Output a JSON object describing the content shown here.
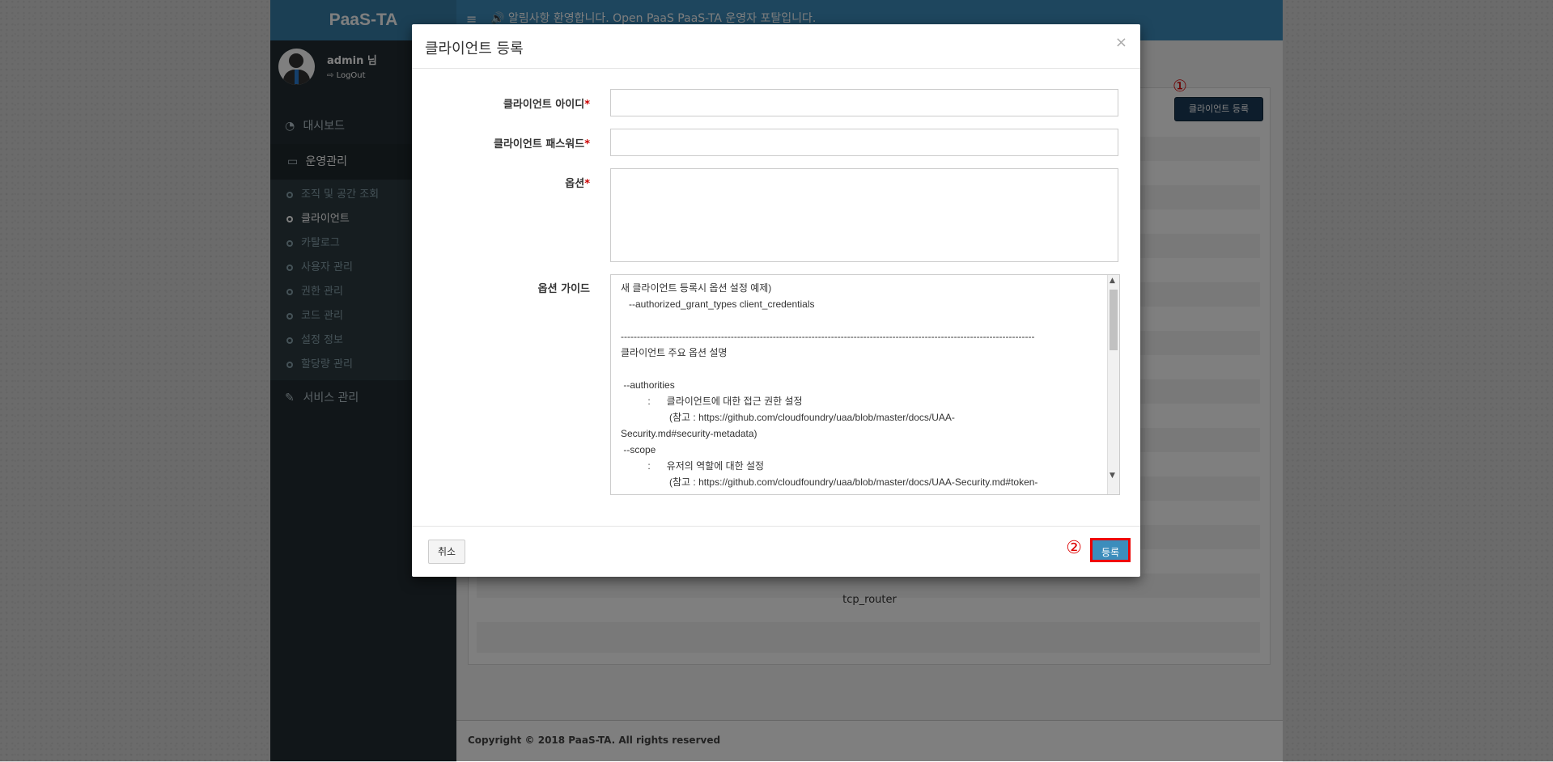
{
  "brand": "PaaS-TA",
  "user": {
    "name": "admin 님",
    "logout": "LogOut"
  },
  "topbar": {
    "hamburger": "≡",
    "notice": "🔊 알림사항 환영합니다. Open PaaS PaaS-TA 운영자 포탈입니다."
  },
  "sidebar": {
    "dashboard": "대시보드",
    "ops": "운영관리",
    "sub": [
      "조직 및 공간 조회",
      "클라이언트",
      "카탈로그",
      "사용자 관리",
      "권한 관리",
      "코드 관리",
      "설정 정보",
      "할당량 관리"
    ],
    "service": "서비스 관리"
  },
  "page": {
    "register_button": "클라이언트 등록",
    "marker1": "①",
    "bottom_cell": "tcp_router"
  },
  "footer": "Copyright © 2018 PaaS-TA. All rights reserved",
  "modal": {
    "title": "클라이언트 등록",
    "close": "×",
    "labels": {
      "client_id": "클라이언트 아이디",
      "client_pw": "클라이언트 패스워드",
      "options": "옵션",
      "guide": "옵션 가이드"
    },
    "required": "*",
    "values": {
      "client_id": "",
      "client_pw": "",
      "options": ""
    },
    "guide_text": "새 클라이언트 등록시 옵션 설정 예제)\n   --authorized_grant_types client_credentials\n\n--------------------------------------------------------------------------------------------------------------------------------\n클라이언트 주요 옵션 설명\n\n --authorities\n          :      클라이언트에 대한 접근 권한 설정\n                  (참고 : https://github.com/cloudfoundry/uaa/blob/master/docs/UAA-\nSecurity.md#security-metadata)\n --scope\n          :      유저의 역할에 대한 설정\n                  (참고 : https://github.com/cloudfoundry/uaa/blob/master/docs/UAA-Security.md#token-",
    "cancel": "취소",
    "submit": "등록",
    "marker2": "②"
  }
}
